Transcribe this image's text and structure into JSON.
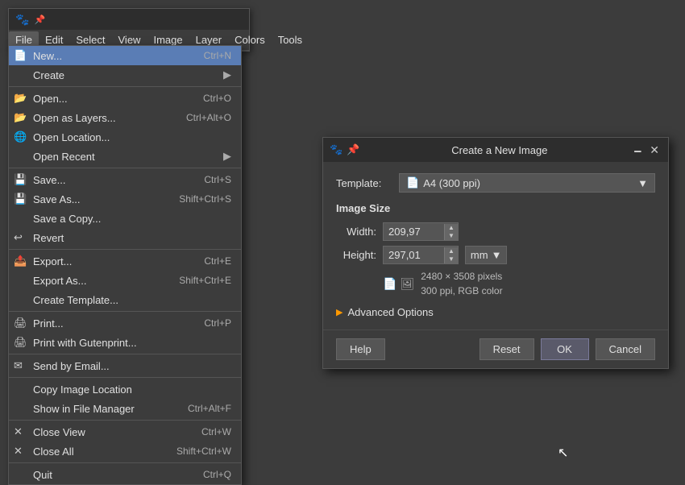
{
  "toolbox": {
    "title_icon": "🐾",
    "pin_icon": "📌"
  },
  "menubar": {
    "items": [
      {
        "id": "file",
        "label": "File"
      },
      {
        "id": "edit",
        "label": "Edit"
      },
      {
        "id": "select",
        "label": "Select"
      },
      {
        "id": "view",
        "label": "View"
      },
      {
        "id": "image",
        "label": "Image"
      },
      {
        "id": "layer",
        "label": "Layer"
      },
      {
        "id": "colors",
        "label": "Colors"
      },
      {
        "id": "tools",
        "label": "Tools"
      }
    ]
  },
  "dropdown": {
    "items": [
      {
        "id": "new",
        "icon": "📄",
        "label": "New...",
        "shortcut": "Ctrl+N",
        "has_icon": true,
        "active": true
      },
      {
        "id": "create",
        "icon": "",
        "label": "Create",
        "has_submenu": true
      },
      {
        "id": "sep1",
        "type": "separator"
      },
      {
        "id": "open",
        "icon": "📂",
        "label": "Open...",
        "shortcut": "Ctrl+O"
      },
      {
        "id": "open-layers",
        "icon": "📂",
        "label": "Open as Layers...",
        "shortcut": "Ctrl+Alt+O"
      },
      {
        "id": "open-location",
        "icon": "🌐",
        "label": "Open Location..."
      },
      {
        "id": "open-recent",
        "icon": "",
        "label": "Open Recent",
        "has_submenu": true
      },
      {
        "id": "sep2",
        "type": "separator"
      },
      {
        "id": "save",
        "icon": "💾",
        "label": "Save...",
        "shortcut": "Ctrl+S"
      },
      {
        "id": "save-as",
        "icon": "💾",
        "label": "Save As...",
        "shortcut": "Shift+Ctrl+S"
      },
      {
        "id": "save-copy",
        "icon": "",
        "label": "Save a Copy..."
      },
      {
        "id": "revert",
        "icon": "↩",
        "label": "Revert",
        "disabled": false
      },
      {
        "id": "sep3",
        "type": "separator"
      },
      {
        "id": "export",
        "icon": "📤",
        "label": "Export...",
        "shortcut": "Ctrl+E"
      },
      {
        "id": "export-as",
        "icon": "",
        "label": "Export As...",
        "shortcut": "Shift+Ctrl+E"
      },
      {
        "id": "create-template",
        "icon": "",
        "label": "Create Template..."
      },
      {
        "id": "sep4",
        "type": "separator"
      },
      {
        "id": "print",
        "icon": "🖨",
        "label": "Print...",
        "shortcut": "Ctrl+P"
      },
      {
        "id": "print-guten",
        "icon": "🖨",
        "label": "Print with Gutenprint..."
      },
      {
        "id": "sep5",
        "type": "separator"
      },
      {
        "id": "send-email",
        "icon": "✉",
        "label": "Send by Email..."
      },
      {
        "id": "sep6",
        "type": "separator"
      },
      {
        "id": "copy-location",
        "icon": "",
        "label": "Copy Image Location"
      },
      {
        "id": "show-manager",
        "icon": "",
        "label": "Show in File Manager",
        "shortcut": "Ctrl+Alt+F"
      },
      {
        "id": "sep7",
        "type": "separator"
      },
      {
        "id": "close-view",
        "icon": "✕",
        "label": "Close View",
        "shortcut": "Ctrl+W"
      },
      {
        "id": "close-all",
        "icon": "✕",
        "label": "Close All",
        "shortcut": "Shift+Ctrl+W"
      },
      {
        "id": "sep8",
        "type": "separator"
      },
      {
        "id": "quit",
        "icon": "",
        "label": "Quit",
        "shortcut": "Ctrl+Q"
      }
    ]
  },
  "dialog": {
    "title": "Create a New Image",
    "title_icon": "🐾",
    "pin_icon": "📌",
    "template_label": "Template:",
    "template_value": "A4 (300 ppi)",
    "template_icon": "📄",
    "image_size_title": "Image Size",
    "width_label": "Width:",
    "width_value": "209,97",
    "height_label": "Height:",
    "height_value": "297,01",
    "unit": "mm",
    "pixels_info": "2480 × 3508 pixels",
    "color_info": "300 ppi, RGB color",
    "advanced_label": "Advanced Options",
    "buttons": {
      "help": "Help",
      "reset": "Reset",
      "ok": "OK",
      "cancel": "Cancel"
    }
  }
}
